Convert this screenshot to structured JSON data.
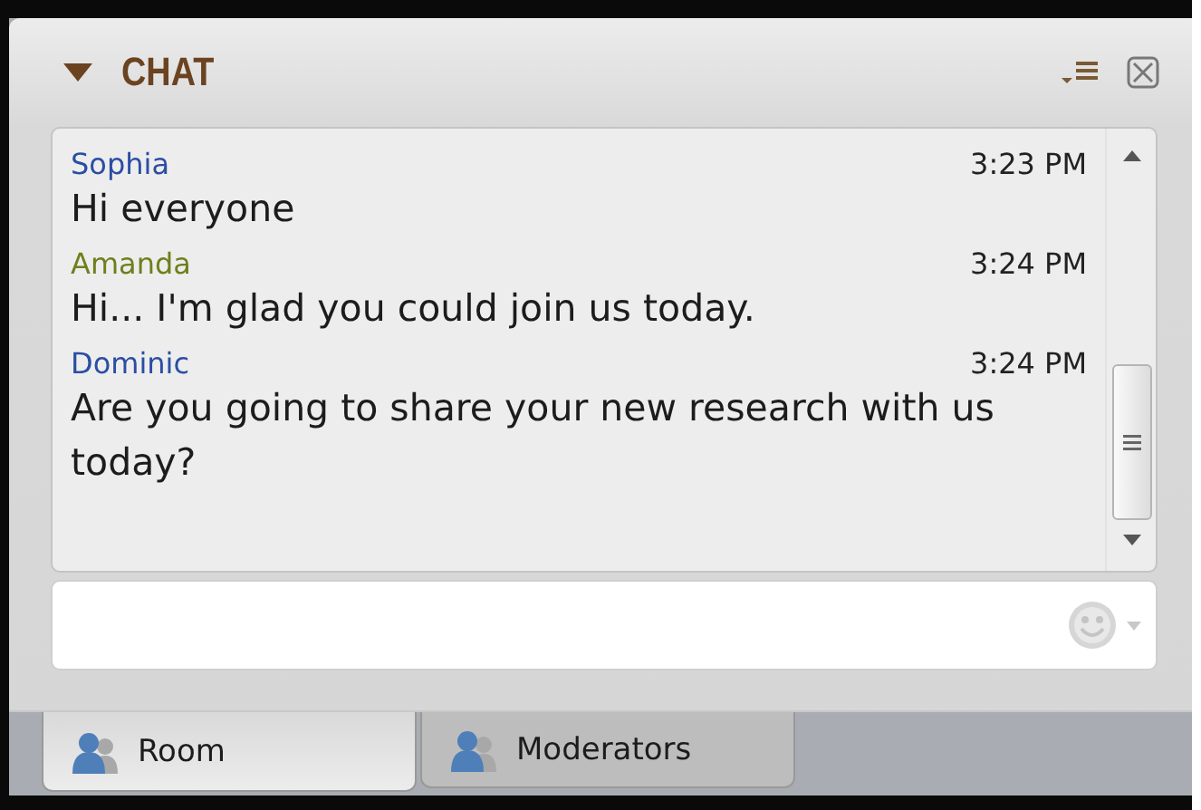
{
  "panel": {
    "title": "CHAT",
    "expanded": true
  },
  "messages": [
    {
      "author": "Sophia",
      "color": "#2b4ea3",
      "time": "3:23 PM",
      "text": "Hi everyone"
    },
    {
      "author": "Amanda",
      "color": "#6f7f1c",
      "time": "3:24 PM",
      "text": "Hi... I'm glad you could join us today."
    },
    {
      "author": "Dominic",
      "color": "#2b4ea3",
      "time": "3:24 PM",
      "text": "Are you going to share your new research with us today?"
    }
  ],
  "tabs": [
    {
      "label": "Room",
      "selected": true
    },
    {
      "label": "Moderators",
      "selected": false
    }
  ]
}
